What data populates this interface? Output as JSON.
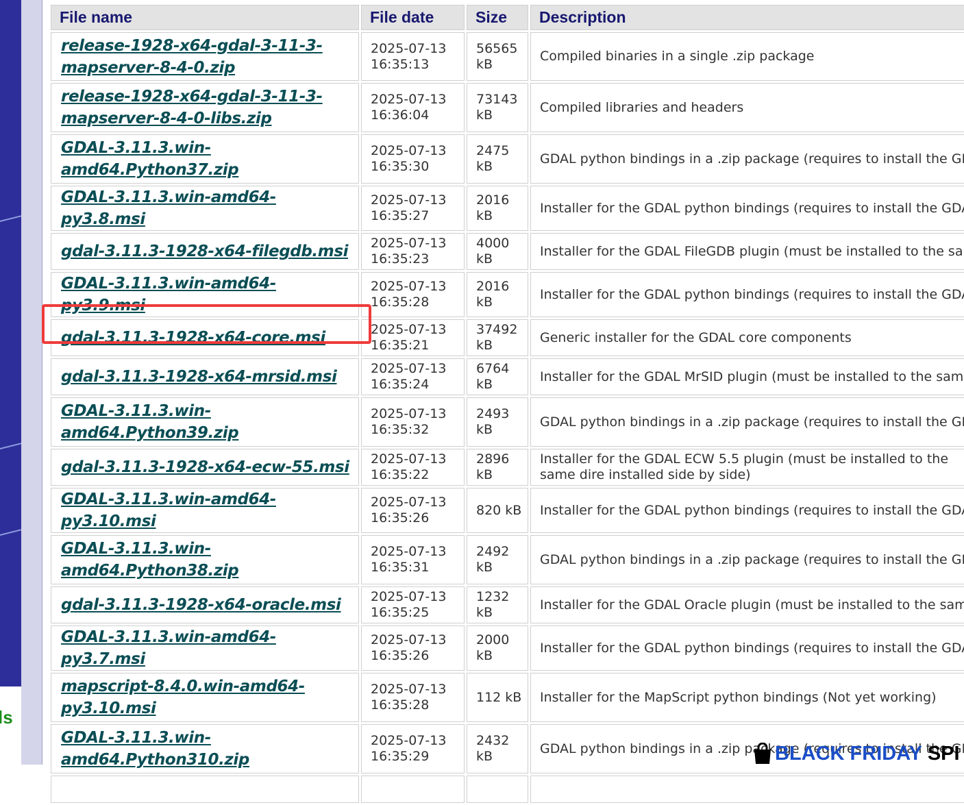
{
  "sidebar": {
    "partial_text": "ls"
  },
  "table": {
    "headers": [
      "File name",
      "File date",
      "Size",
      "Description"
    ],
    "rows": [
      {
        "name": "release-1928-x64-gdal-3-11-3-mapserver-8-4-0.zip",
        "date": "2025-07-13 16:35:13",
        "size": "56565 kB",
        "description": "Compiled binaries in a single .zip package"
      },
      {
        "name": "release-1928-x64-gdal-3-11-3-mapserver-8-4-0-libs.zip",
        "date": "2025-07-13 16:36:04",
        "size": "73143 kB",
        "description": "Compiled libraries and headers"
      },
      {
        "name": "GDAL-3.11.3.win-amd64.Python37.zip",
        "date": "2025-07-13 16:35:30",
        "size": "2475 kB",
        "description": "GDAL python bindings in a .zip package (requires to install the GDAL core"
      },
      {
        "name": "GDAL-3.11.3.win-amd64-py3.8.msi",
        "date": "2025-07-13 16:35:27",
        "size": "2016 kB",
        "description": "Installer for the GDAL python bindings (requires to install the GDAL core)"
      },
      {
        "name": "gdal-3.11.3-1928-x64-filegdb.msi",
        "date": "2025-07-13 16:35:23",
        "size": "4000 kB",
        "description": "Installer for the GDAL FileGDB plugin (must be installed to the same direc"
      },
      {
        "name": "GDAL-3.11.3.win-amd64-py3.9.msi",
        "date": "2025-07-13 16:35:28",
        "size": "2016 kB",
        "description": "Installer for the GDAL python bindings (requires to install the GDAL core)"
      },
      {
        "name": "gdal-3.11.3-1928-x64-core.msi",
        "date": "2025-07-13 16:35:21",
        "size": "37492 kB",
        "description": "Generic installer for the GDAL core components"
      },
      {
        "name": "gdal-3.11.3-1928-x64-mrsid.msi",
        "date": "2025-07-13 16:35:24",
        "size": "6764 kB",
        "description": "Installer for the GDAL MrSID plugin (must be installed to the same directo"
      },
      {
        "name": "GDAL-3.11.3.win-amd64.Python39.zip",
        "date": "2025-07-13 16:35:32",
        "size": "2493 kB",
        "description": "GDAL python bindings in a .zip package (requires to install the GDAL core"
      },
      {
        "name": "gdal-3.11.3-1928-x64-ecw-55.msi",
        "date": "2025-07-13 16:35:22",
        "size": "2896 kB",
        "description": "Installer for the GDAL ECW 5.5 plugin (must be installed to the same dire installed side by side)"
      },
      {
        "name": "GDAL-3.11.3.win-amd64-py3.10.msi",
        "date": "2025-07-13 16:35:26",
        "size": "820 kB",
        "description": "Installer for the GDAL python bindings (requires to install the GDAL core)"
      },
      {
        "name": "GDAL-3.11.3.win-amd64.Python38.zip",
        "date": "2025-07-13 16:35:31",
        "size": "2492 kB",
        "description": "GDAL python bindings in a .zip package (requires to install the GDAL core"
      },
      {
        "name": "gdal-3.11.3-1928-x64-oracle.msi",
        "date": "2025-07-13 16:35:25",
        "size": "1232 kB",
        "description": "Installer for the GDAL Oracle plugin (must be installed to the same directo"
      },
      {
        "name": "GDAL-3.11.3.win-amd64-py3.7.msi",
        "date": "2025-07-13 16:35:26",
        "size": "2000 kB",
        "description": "Installer for the GDAL python bindings (requires to install the GDAL core)"
      },
      {
        "name": "mapscript-8.4.0.win-amd64-py3.10.msi",
        "date": "2025-07-13 16:35:28",
        "size": "112 kB",
        "description": "Installer for the MapScript python bindings (Not yet working)"
      },
      {
        "name": "GDAL-3.11.3.win-amd64.Python310.zip",
        "date": "2025-07-13 16:35:29",
        "size": "2432 kB",
        "description": "GDAL python bindings in a .zip package (requires to install the GDAL core"
      }
    ]
  },
  "banner": {
    "text": "BLACK FRIDAY",
    "tail": "SPI",
    "icon": "shopping-bag-icon"
  },
  "colors": {
    "link": "#0b4e55",
    "header_text": "#181870",
    "highlight": "#ef3b3b",
    "sidebar": "#2e2e9a",
    "banner": "#1b4ec7"
  }
}
